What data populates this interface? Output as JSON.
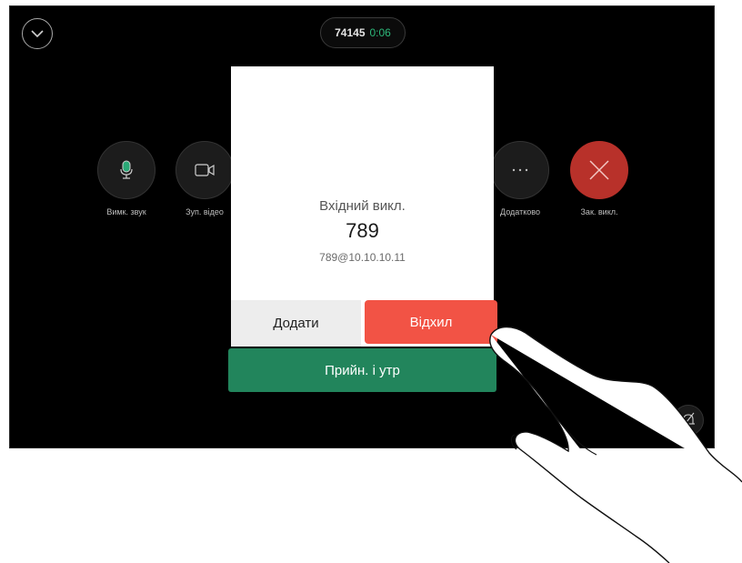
{
  "header": {
    "call_number": "74145",
    "call_timer": "0:06"
  },
  "controls": {
    "mute_label": "Вимк. звук",
    "video_label": "Зуп. відео",
    "more_label": "Додатково",
    "end_label": "Зак. викл."
  },
  "incoming_call": {
    "title": "Вхідний викл.",
    "caller_name": "789",
    "caller_address": "789@10.10.10.11",
    "add_label": "Додати",
    "decline_label": "Відхил",
    "accept_label": "Прийн. і утр"
  },
  "colors": {
    "accept": "#22855c",
    "decline": "#f25345",
    "end_call": "#b8312a",
    "timer": "#2db87a",
    "mic_accent": "#2aa876"
  },
  "icons": [
    "chevron-down-icon",
    "microphone-icon",
    "video-camera-icon",
    "more-dots-icon",
    "close-x-icon",
    "bell-slash-icon",
    "hand-pointer-icon"
  ]
}
